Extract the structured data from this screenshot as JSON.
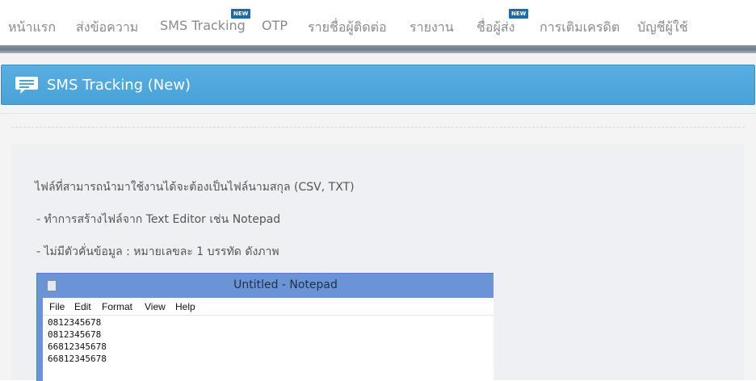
{
  "nav": {
    "items": [
      {
        "label": "หน้าแรก"
      },
      {
        "label": "ส่งข้อความ"
      },
      {
        "label": "SMS Tracking",
        "badge": "NEW"
      },
      {
        "label": "OTP"
      },
      {
        "label": "รายชื่อผู้ติดต่อ"
      },
      {
        "label": "รายงาน"
      },
      {
        "label": "ชื่อผู้ส่ง",
        "badge": "NEW"
      },
      {
        "label": "การเติมเครดิต"
      },
      {
        "label": "บัญชีผู้ใช้"
      }
    ]
  },
  "header": {
    "title": "SMS Tracking (New)",
    "icon": "chat-bubble-icon"
  },
  "instructions": {
    "line1": "ไฟล์ที่สามารถนำมาใช้งานได้จะต้องเป็นไฟล์นามสกุล (CSV, TXT)",
    "line2": "- ทำการสร้างไฟล์จาก Text Editor เช่น Notepad",
    "line3": "- ไม่มีตัวคั่นข้อมูล : หมายเลขละ 1 บรรทัด ดังภาพ"
  },
  "notepad": {
    "title": "Untitled - Notepad",
    "menu": [
      "File",
      "Edit",
      "Format",
      "View",
      "Help"
    ],
    "lines": [
      "0812345678",
      "0812345678",
      "66812345678",
      "66812345678"
    ]
  },
  "colors": {
    "header_bg": "#4aa4da",
    "badge_bg": "#1c6aa6",
    "nav_text": "#8a8a8a"
  }
}
